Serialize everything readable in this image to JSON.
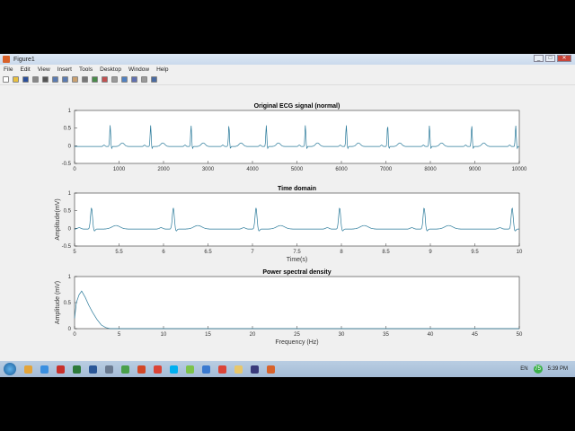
{
  "window": {
    "title": "Figure1",
    "controls": [
      "_",
      "□",
      "✕"
    ]
  },
  "menu": [
    "File",
    "Edit",
    "View",
    "Insert",
    "Tools",
    "Desktop",
    "Window",
    "Help"
  ],
  "toolbar": [
    "new-figure",
    "open",
    "save",
    "print",
    "pointer",
    "zoom-in",
    "zoom-out",
    "pan",
    "rotate",
    "data-cursor",
    "brush",
    "link",
    "colorbar",
    "legend",
    "hide-plot-tools",
    "show-plot-tools"
  ],
  "taskbar": {
    "apps": [
      {
        "name": "explorer",
        "color": "#e3a43a"
      },
      {
        "name": "ie",
        "color": "#3a8fe0"
      },
      {
        "name": "acrobat",
        "color": "#c8302a"
      },
      {
        "name": "excel",
        "color": "#2d7a3a"
      },
      {
        "name": "word",
        "color": "#2b5797"
      },
      {
        "name": "app",
        "color": "#6a7a90"
      },
      {
        "name": "ie2",
        "color": "#4aa04a"
      },
      {
        "name": "powerpoint",
        "color": "#d24726"
      },
      {
        "name": "chrome",
        "color": "#db4437"
      },
      {
        "name": "skype",
        "color": "#00aff0"
      },
      {
        "name": "app2",
        "color": "#7cc34a"
      },
      {
        "name": "app3",
        "color": "#3a7ad0"
      },
      {
        "name": "chrome2",
        "color": "#db4437"
      },
      {
        "name": "folder",
        "color": "#e8c76a"
      },
      {
        "name": "app4",
        "color": "#3a3a7a"
      },
      {
        "name": "matlab",
        "color": "#d8622a"
      }
    ],
    "lang": "EN",
    "battery": "75",
    "clock": "5:39 PM"
  },
  "chart_data": [
    {
      "type": "line",
      "title": "Original ECG signal (normal)",
      "xlabel": "",
      "ylabel": "",
      "xlim": [
        0,
        10000
      ],
      "ylim": [
        -0.5,
        1
      ],
      "xticks": [
        "0",
        "1000",
        "2000",
        "3000",
        "4000",
        "5000",
        "6000",
        "7000",
        "8000",
        "9000",
        "10000"
      ],
      "yticks": [
        "-0.5",
        "0",
        "0.5",
        "1"
      ],
      "r_peaks": [
        800,
        1710,
        2620,
        3470,
        4310,
        5190,
        6110,
        7040,
        7980,
        8930,
        9920
      ],
      "r_amplitude": 0.6,
      "baseline": -0.02
    },
    {
      "type": "line",
      "title": "Time domain",
      "xlabel": "Time(s)",
      "ylabel": "Amplitude(mV)",
      "xlim": [
        5,
        10
      ],
      "ylim": [
        -0.5,
        1
      ],
      "xticks": [
        "5",
        "5.5",
        "6",
        "6.5",
        "7",
        "7.5",
        "8",
        "8.5",
        "9",
        "9.5",
        "10"
      ],
      "yticks": [
        "-0.5",
        "0",
        "0.5",
        "1"
      ],
      "r_peaks": [
        5.19,
        6.11,
        7.04,
        7.98,
        8.93,
        9.92
      ],
      "r_amplitude": 0.6,
      "baseline": -0.02
    },
    {
      "type": "line",
      "title": "Power spectral density",
      "xlabel": "Frequency (Hz)",
      "ylabel": "Amplitude (mV)",
      "xlim": [
        0,
        50
      ],
      "ylim": [
        0,
        1
      ],
      "xticks": [
        "0",
        "5",
        "10",
        "15",
        "20",
        "25",
        "30",
        "35",
        "40",
        "45",
        "50"
      ],
      "yticks": [
        "0",
        "0.5",
        "1"
      ],
      "x": [
        0,
        0.2,
        0.5,
        0.8,
        1.2,
        1.6,
        2,
        2.5,
        3,
        3.5,
        4,
        50
      ],
      "y": [
        0.2,
        0.5,
        0.65,
        0.72,
        0.6,
        0.45,
        0.32,
        0.18,
        0.07,
        0.02,
        0,
        0
      ]
    }
  ]
}
